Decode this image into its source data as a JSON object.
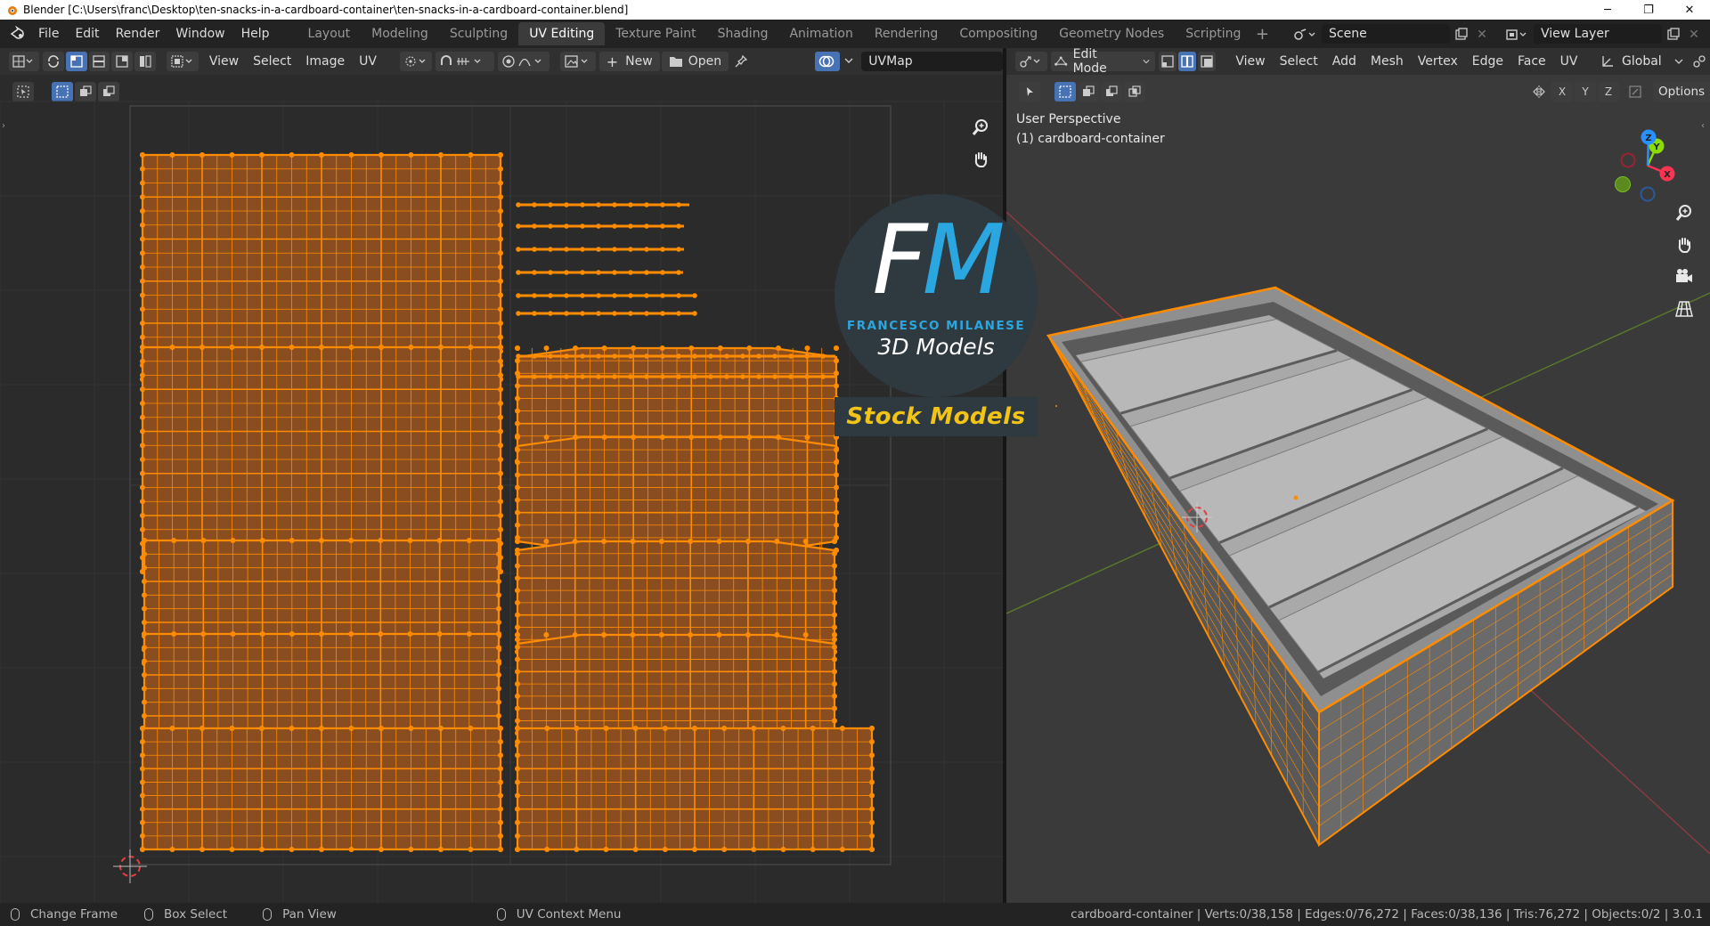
{
  "window": {
    "title": "Blender [C:\\Users\\franc\\Desktop\\ten-snacks-in-a-cardboard-container\\ten-snacks-in-a-cardboard-container.blend]",
    "minimize": "─",
    "restore": "❐",
    "close": "✕"
  },
  "topbar": {
    "menus": [
      "File",
      "Edit",
      "Render",
      "Window",
      "Help"
    ],
    "workspaces": [
      "Layout",
      "Modeling",
      "Sculpting",
      "UV Editing",
      "Texture Paint",
      "Shading",
      "Animation",
      "Rendering",
      "Compositing",
      "Geometry Nodes",
      "Scripting"
    ],
    "active_workspace": "UV Editing",
    "add_workspace": "+",
    "scene": "Scene",
    "view_layer": "View Layer"
  },
  "uv_editor": {
    "menus": [
      "View",
      "Select",
      "Image",
      "UV"
    ],
    "new_label": "New",
    "open_label": "Open",
    "uvmap": "UVMap"
  },
  "viewport": {
    "mode": "Edit Mode",
    "menus": [
      "View",
      "Select",
      "Add",
      "Mesh",
      "Vertex",
      "Edge",
      "Face",
      "UV"
    ],
    "transform_orientation": "Global",
    "axis_labels": [
      "X",
      "Y",
      "Z"
    ],
    "options_label": "Options",
    "perspective": "User Perspective",
    "object_label": "(1) cardboard-container",
    "gizmo": {
      "x": "X",
      "y": "Y",
      "z": "Z"
    }
  },
  "watermark": {
    "f": "F",
    "m": "M",
    "name": "FRANCESCO MILANESE",
    "subtitle": "3D Models",
    "banner": "Stock Models"
  },
  "statusbar": {
    "items": [
      "Change Frame",
      "Box Select",
      "Pan View",
      "UV Context Menu"
    ],
    "stats": "cardboard-container | Verts:0/38,158 | Edges:0/76,272 | Faces:0/38,136 | Tris:76,272 | Objects:0/2 | 3.0.1"
  },
  "colors": {
    "accent_blue": "#4772b3",
    "uv_orange": "#ff8c00",
    "uv_fill": "#8a4d1f",
    "axis_red": "#ff3352",
    "axis_green": "#8bdc00",
    "axis_blue": "#2890ff"
  }
}
